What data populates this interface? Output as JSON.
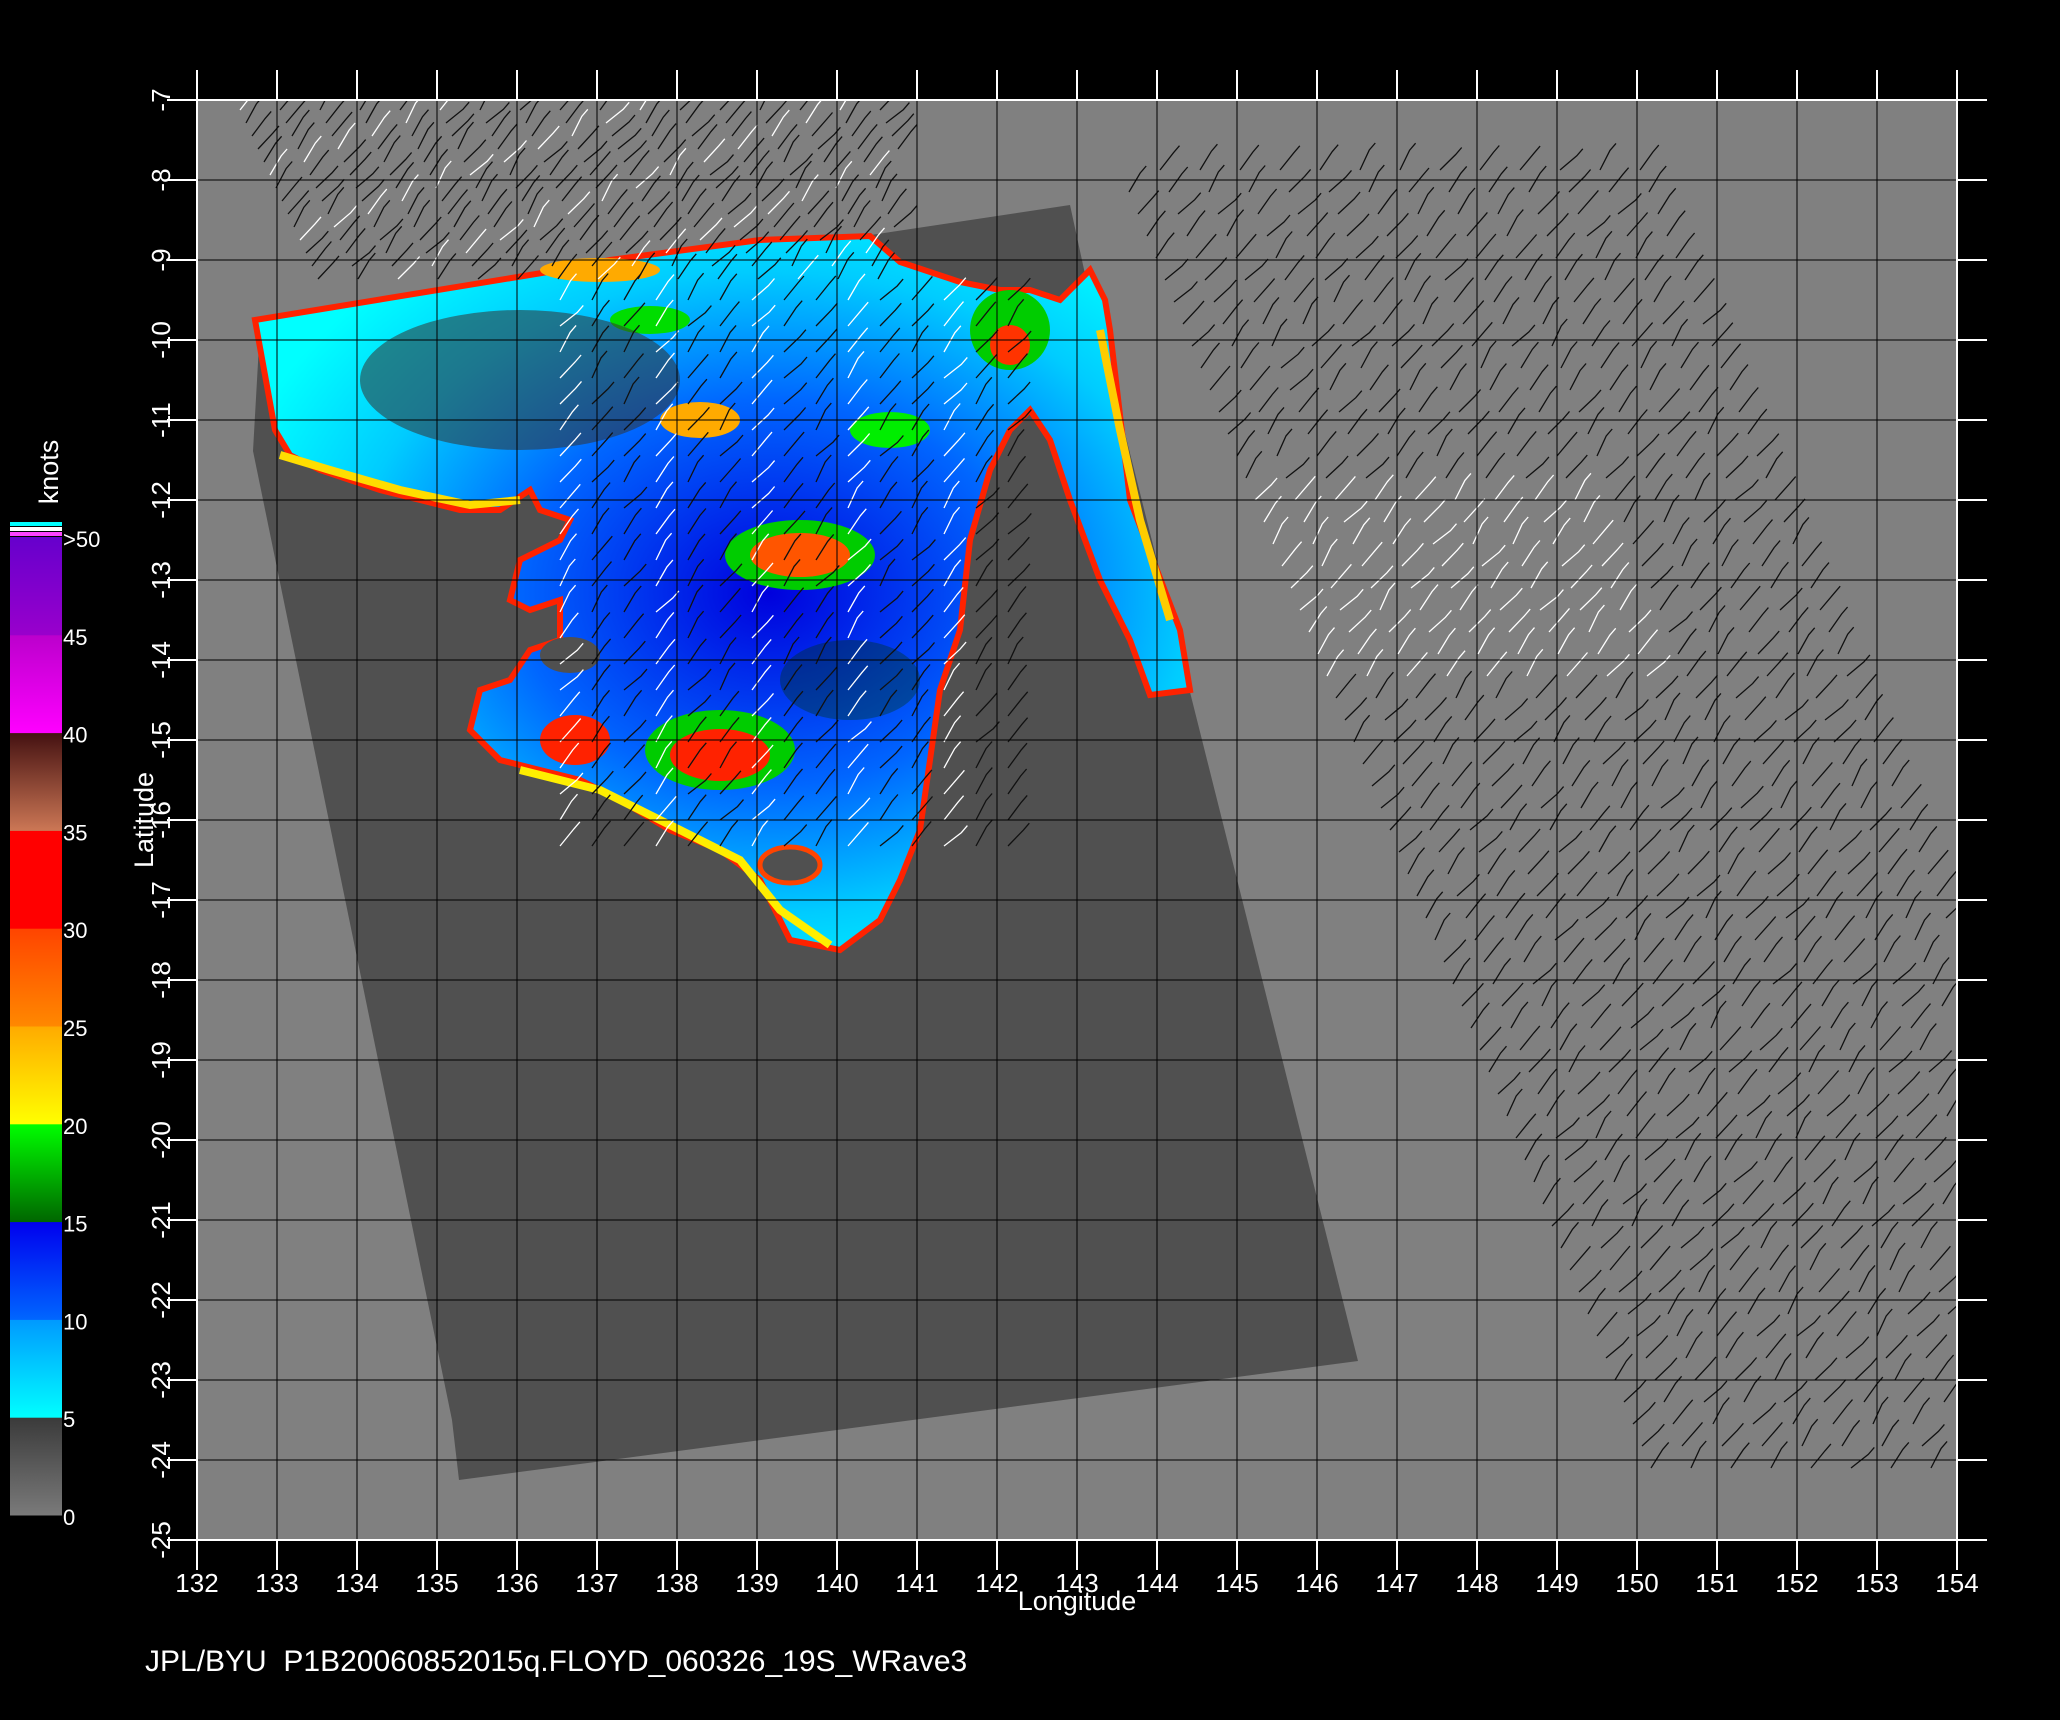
{
  "footer_text": "JPL/BYU  P1B20060852015q.FLOYD_060326_19S_WRave3",
  "chart_data": {
    "type": "heatmap",
    "xlabel": "Longitude",
    "ylabel": "Latitude",
    "xlim": [
      132,
      154
    ],
    "ylim": [
      -25,
      -7
    ],
    "x_ticks": [
      132,
      133,
      134,
      135,
      136,
      137,
      138,
      139,
      140,
      141,
      142,
      143,
      144,
      145,
      146,
      147,
      148,
      149,
      150,
      151,
      152,
      153,
      154
    ],
    "y_ticks": [
      -7,
      -8,
      -9,
      -10,
      -11,
      -12,
      -13,
      -14,
      -15,
      -16,
      -17,
      -18,
      -19,
      -20,
      -21,
      -22,
      -23,
      -24,
      -25
    ],
    "grid": true,
    "colorbar": {
      "title": "knots",
      "ticks": [
        "0",
        "5",
        "10",
        "15",
        "20",
        "25",
        "30",
        "35",
        "40",
        "45",
        ">50"
      ],
      "stops": [
        {
          "from": 0,
          "to": 5,
          "colors": [
            "#7a7a7a",
            "#3a3a3a"
          ]
        },
        {
          "from": 5,
          "to": 10,
          "colors": [
            "#00ffff",
            "#0099ff"
          ]
        },
        {
          "from": 10,
          "to": 15,
          "colors": [
            "#0066ff",
            "#0000ee"
          ]
        },
        {
          "from": 15,
          "to": 20,
          "colors": [
            "#006600",
            "#00ff00"
          ]
        },
        {
          "from": 20,
          "to": 25,
          "colors": [
            "#ffff00",
            "#ffaa00"
          ]
        },
        {
          "from": 25,
          "to": 30,
          "colors": [
            "#ff8800",
            "#ff4400"
          ]
        },
        {
          "from": 30,
          "to": 35,
          "colors": [
            "#ff0000",
            "#ff0000"
          ]
        },
        {
          "from": 35,
          "to": 40,
          "colors": [
            "#cc7755",
            "#441111"
          ]
        },
        {
          "from": 40,
          "to": 45,
          "colors": [
            "#ff00ff",
            "#bb00cc"
          ]
        },
        {
          "from": 45,
          "to": 50,
          "colors": [
            "#9900cc",
            "#6600cc"
          ]
        }
      ],
      "top_stripes": [
        "#00ffff",
        "#ffffff",
        "#ff44ff"
      ]
    },
    "colors": {
      "background_gray": "#808080",
      "swath_gray": "#505050",
      "land_high": "#ff1111",
      "land_mid": "#00ee00",
      "land_low": "#0044ff",
      "wind_barbs": "#111111",
      "wind_barbs_light": "#ffffff"
    }
  }
}
